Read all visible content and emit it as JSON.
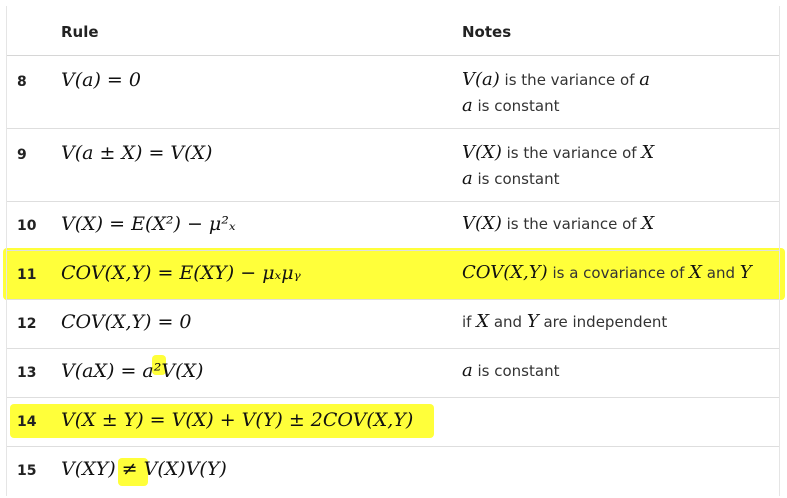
{
  "table": {
    "headers": {
      "rule": "Rule",
      "notes": "Notes"
    },
    "rows": [
      {
        "num": "8",
        "rule": "V(a) = 0",
        "note1_math": "V(a)",
        "note1_text": " is the variance of ",
        "note1_math2": "a",
        "note2_math": "a",
        "note2_text": " is constant"
      },
      {
        "num": "9",
        "rule": "V(a ± X) = V(X)",
        "note1_math": "V(X)",
        "note1_text": " is the variance of ",
        "note1_math2": "X",
        "note2_math": "a",
        "note2_text": " is constant"
      },
      {
        "num": "10",
        "rule": "V(X) = E(X²) − μ²ₓ",
        "note1_math": "V(X)",
        "note1_text": " is the variance of ",
        "note1_math2": "X"
      },
      {
        "num": "11",
        "rule": "COV(X,Y) = E(XY) − μₓμᵧ",
        "note1_math": "COV(X,Y)",
        "note1_text": " is a covariance of ",
        "note1_math2": "X",
        "note1_text2": " and ",
        "note1_math3": "Y"
      },
      {
        "num": "12",
        "rule": "COV(X,Y) = 0",
        "note1_text0": "if ",
        "note1_math": "X",
        "note1_text": " and ",
        "note1_math2": "Y",
        "note1_text2": " are independent"
      },
      {
        "num": "13",
        "rule": "V(aX) = a²V(X)",
        "note1_math": "a",
        "note1_text": " is constant"
      },
      {
        "num": "14",
        "rule": "V(X ± Y) = V(X) + V(Y) ± 2COV(X,Y)"
      },
      {
        "num": "15",
        "rule": "V(XY) ≠ V(X)V(Y)"
      }
    ]
  },
  "colors": {
    "highlight": "#ffff3a",
    "border": "#dedede"
  }
}
